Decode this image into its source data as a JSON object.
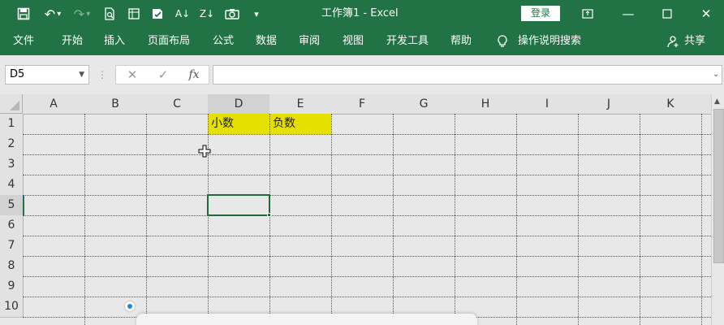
{
  "title": "工作簿1 - Excel",
  "login_label": "登录",
  "menu": [
    "文件",
    "开始",
    "插入",
    "页面布局",
    "公式",
    "数据",
    "审阅",
    "视图",
    "开发工具",
    "帮助"
  ],
  "tell_me": "操作说明搜索",
  "share_label": "共享",
  "name_box": "D5",
  "columns": [
    "A",
    "B",
    "C",
    "D",
    "E",
    "F",
    "G",
    "H",
    "I",
    "J",
    "K"
  ],
  "rows": [
    "1",
    "2",
    "3",
    "4",
    "5",
    "6",
    "7",
    "8",
    "9",
    "10"
  ],
  "cells": {
    "D1": "小数",
    "E1": "负数"
  },
  "colors": {
    "ribbon": "#217346",
    "highlight": "#e5e000",
    "selection": "#1e6b3a"
  }
}
